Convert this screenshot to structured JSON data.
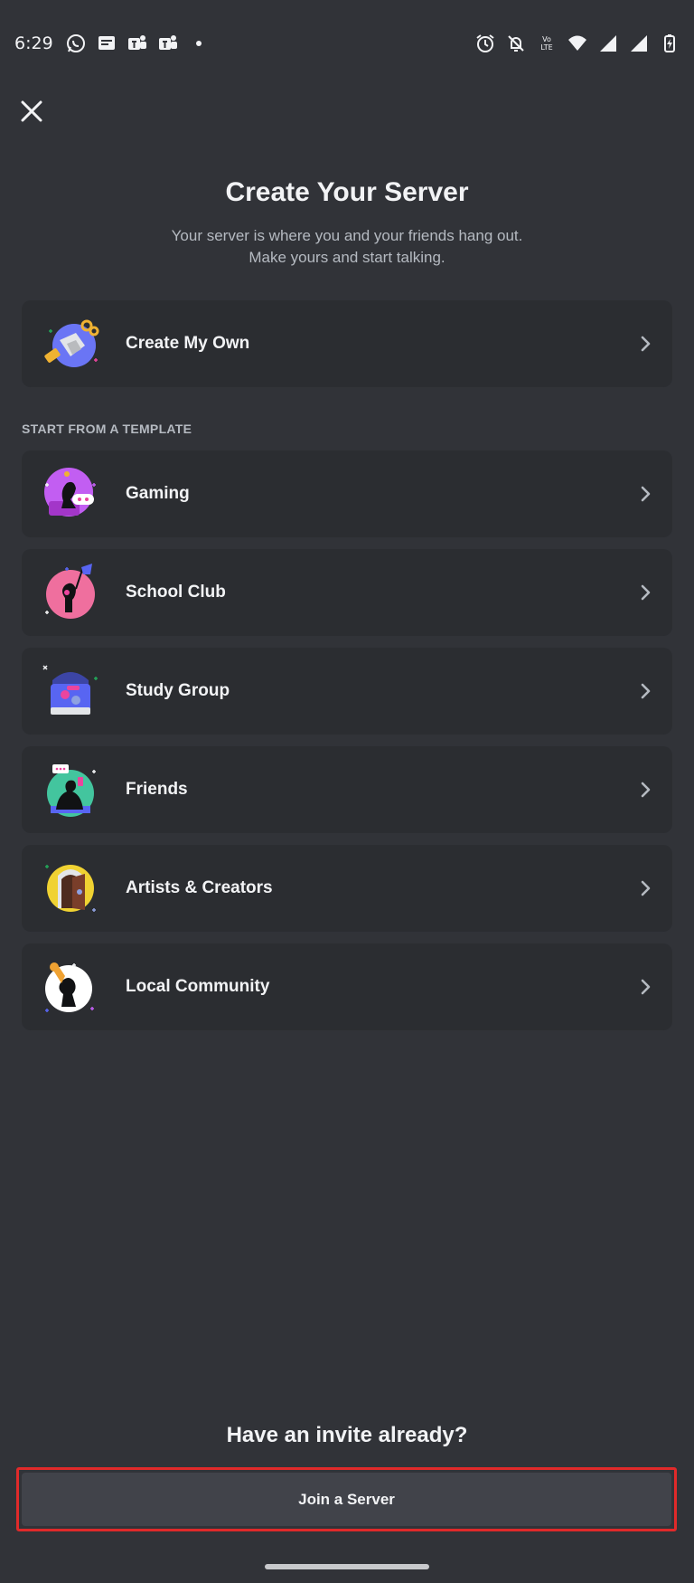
{
  "status_bar": {
    "time": "6:29",
    "left_icons": [
      "whatsapp-icon",
      "messages-icon",
      "teams-icon",
      "teams-icon",
      "notification-dot-icon"
    ],
    "right_icons": [
      "alarm-icon",
      "bell-off-icon",
      "volte-icon",
      "wifi-icon",
      "signal-icon",
      "signal-icon",
      "battery-charging-icon"
    ]
  },
  "header": {
    "title": "Create Your Server",
    "subtitle_line1": "Your server is where you and your friends hang out.",
    "subtitle_line2": "Make yours and start talking."
  },
  "create_own": {
    "label": "Create My Own"
  },
  "template_section": {
    "label": "START FROM A TEMPLATE",
    "items": [
      {
        "label": "Gaming",
        "icon": "gaming-illustration-icon"
      },
      {
        "label": "School Club",
        "icon": "school-club-illustration-icon"
      },
      {
        "label": "Study Group",
        "icon": "study-group-illustration-icon"
      },
      {
        "label": "Friends",
        "icon": "friends-illustration-icon"
      },
      {
        "label": "Artists & Creators",
        "icon": "artists-illustration-icon"
      },
      {
        "label": "Local Community",
        "icon": "local-community-illustration-icon"
      }
    ]
  },
  "footer": {
    "invite_prompt": "Have an invite already?",
    "join_label": "Join a Server"
  },
  "colors": {
    "background": "#313338",
    "card": "#2b2d31",
    "button": "#41434a",
    "highlight": "#e02a2a",
    "text_primary": "#f2f3f5",
    "text_secondary": "#b5bac1"
  }
}
